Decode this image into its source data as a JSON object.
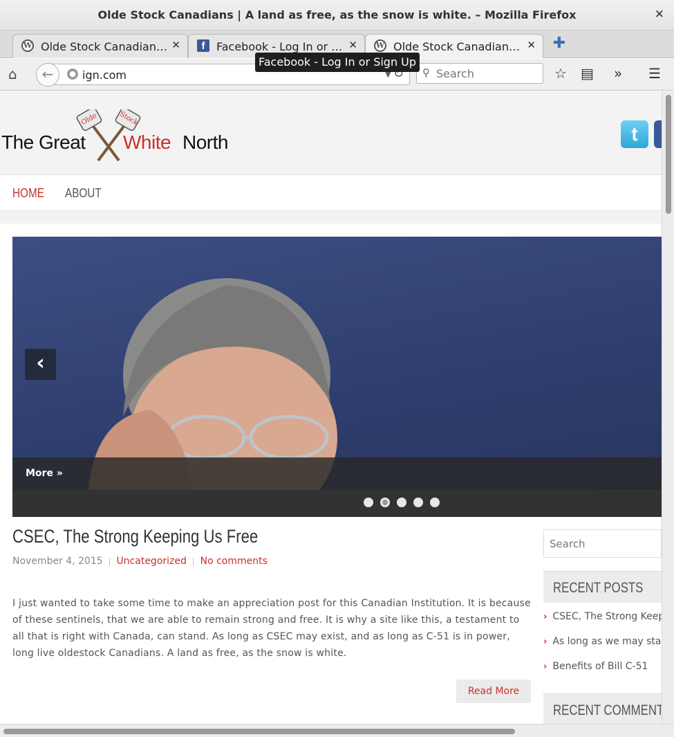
{
  "window": {
    "title": "Olde Stock Canadians | A land as free, as the snow is white. – Mozilla Firefox"
  },
  "tabs": [
    {
      "label": "Olde Stock Canadian…",
      "favicon": "wordpress-icon",
      "active": false
    },
    {
      "label": "Facebook - Log In or …",
      "favicon": "facebook-icon",
      "active": false
    },
    {
      "label": "Olde Stock Canadian…",
      "favicon": "wordpress-icon",
      "active": true
    }
  ],
  "tooltip": "Facebook - Log In or Sign Up",
  "navbar": {
    "url": "ign.com",
    "search_placeholder": "Search"
  },
  "site": {
    "logo": {
      "part1": "The Great",
      "part2": "White",
      "part3": "North",
      "axe_left": "Olde",
      "axe_right": "Stock"
    },
    "nav": [
      {
        "label": "HOME",
        "active": true
      },
      {
        "label": "ABOUT",
        "active": false
      }
    ],
    "slider": {
      "caption_more": "More »",
      "dots": 5,
      "active_dot": 2
    },
    "post": {
      "title": "CSEC, The Strong Keeping Us Free",
      "date": "November 4, 2015",
      "category": "Uncategorized",
      "comments": "No comments",
      "body": "I just wanted to take some time to make an appreciation post for this Canadian Institution. It is because of these sentinels, that we are able to remain strong and free. It is why a site like this, a testament to all that is right with Canada, can stand. As long as CSEC may exist, and as long as C-51 is in power, long live oldestock Canadians. A land as free, as the snow is white.",
      "read_more": "Read More"
    },
    "sidebar": {
      "search_placeholder": "Search",
      "recent_posts_title": "RECENT POSTS",
      "recent_posts": [
        "CSEC, The Strong Keeping Us Free",
        "As long as we may stand",
        "Benefits of Bill C-51"
      ],
      "recent_comments_title": "RECENT COMMENTS"
    }
  },
  "colors": {
    "accent_red": "#c7312b",
    "facebook_blue": "#3b5998",
    "twitter_blue": "#2ea7d9"
  }
}
